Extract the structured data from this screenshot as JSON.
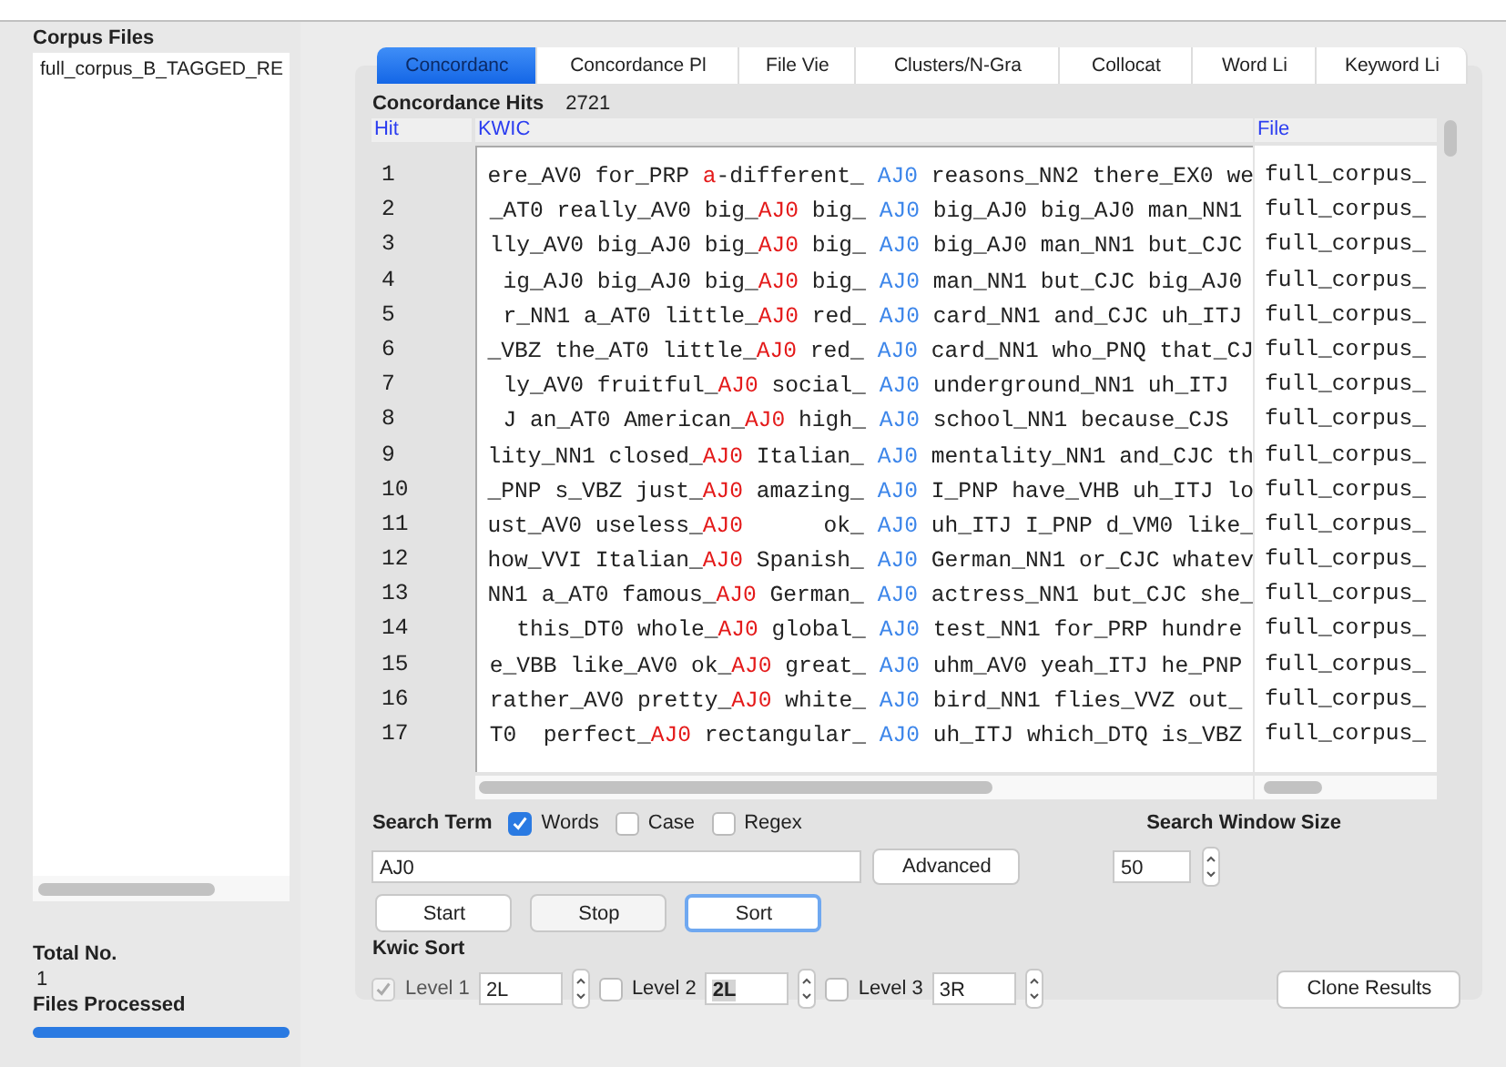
{
  "corpus_files": {
    "title": "Corpus Files",
    "items": [
      "full_corpus_B_TAGGED_RE"
    ]
  },
  "totals": {
    "total_label": "Total No.",
    "total_value": "1",
    "processed_label": "Files Processed",
    "progress": {
      "level": 1
    }
  },
  "tabs": [
    {
      "label": "Concordanc",
      "selected": true
    },
    {
      "label": "Concordance Pl",
      "selected": false
    },
    {
      "label": "File Vie",
      "selected": false
    },
    {
      "label": "Clusters/N-Gra",
      "selected": false
    },
    {
      "label": "Collocat",
      "selected": false
    },
    {
      "label": "Word Li",
      "selected": false
    },
    {
      "label": "Keyword Li",
      "selected": false
    }
  ],
  "hits": {
    "label": "Concordance Hits",
    "value": "2721"
  },
  "table": {
    "columns": [
      "Hit",
      "KWIC",
      "File"
    ],
    "rows": [
      {
        "hit": "1",
        "left": [
          {
            "text": "ere_AV0 for_PRP ",
            "sort_word": false
          },
          {
            "text": "a",
            "sort_word": true
          },
          {
            "text": "-different_",
            "sort_word": false
          }
        ],
        "keyword": "AJ0",
        "right": " reasons_NN2 there_EX0 we",
        "file": "full_corpus_"
      },
      {
        "hit": "2",
        "left": [
          {
            "text": "_AT0 really_AV0 big_",
            "sort_word": false
          },
          {
            "text": "AJ0",
            "sort_word": true
          },
          {
            "text": " big_",
            "sort_word": false
          }
        ],
        "keyword": "AJ0",
        "right": " big_AJ0 big_AJ0 man_NN1",
        "file": "full_corpus_"
      },
      {
        "hit": "3",
        "left": [
          {
            "text": "lly_AV0 big_AJ0 big_",
            "sort_word": false
          },
          {
            "text": "AJ0",
            "sort_word": true
          },
          {
            "text": " big_",
            "sort_word": false
          }
        ],
        "keyword": "AJ0",
        "right": " big_AJ0 man_NN1 but_CJC",
        "file": "full_corpus_"
      },
      {
        "hit": "4",
        "left": [
          {
            "text": "ig_AJ0 big_AJ0 big_",
            "sort_word": false
          },
          {
            "text": "AJ0",
            "sort_word": true
          },
          {
            "text": " big_",
            "sort_word": false
          }
        ],
        "keyword": "AJ0",
        "right": " man_NN1 but_CJC big_AJ0",
        "file": "full_corpus_"
      },
      {
        "hit": "5",
        "left": [
          {
            "text": "r_NN1 a_AT0 little_",
            "sort_word": false
          },
          {
            "text": "AJ0",
            "sort_word": true
          },
          {
            "text": " red_",
            "sort_word": false
          }
        ],
        "keyword": "AJ0",
        "right": " card_NN1 and_CJC uh_ITJ",
        "file": "full_corpus_"
      },
      {
        "hit": "6",
        "left": [
          {
            "text": "_VBZ the_AT0 little_",
            "sort_word": false
          },
          {
            "text": "AJ0",
            "sort_word": true
          },
          {
            "text": " red_",
            "sort_word": false
          }
        ],
        "keyword": "AJ0",
        "right": " card_NN1 who_PNQ that_CJ",
        "file": "full_corpus_"
      },
      {
        "hit": "7",
        "left": [
          {
            "text": "ly_AV0 fruitful_",
            "sort_word": false
          },
          {
            "text": "AJ0",
            "sort_word": true
          },
          {
            "text": " social_",
            "sort_word": false
          }
        ],
        "keyword": "AJ0",
        "right": " underground_NN1 uh_ITJ",
        "file": "full_corpus_"
      },
      {
        "hit": "8",
        "left": [
          {
            "text": "J an_AT0 American_",
            "sort_word": false
          },
          {
            "text": "AJ0",
            "sort_word": true
          },
          {
            "text": " high_",
            "sort_word": false
          }
        ],
        "keyword": "AJ0",
        "right": " school_NN1 because_CJS",
        "file": "full_corpus_"
      },
      {
        "hit": "9",
        "left": [
          {
            "text": "lity_NN1 closed_",
            "sort_word": false
          },
          {
            "text": "AJ0",
            "sort_word": true
          },
          {
            "text": " Italian_",
            "sort_word": false
          }
        ],
        "keyword": "AJ0",
        "right": " mentality_NN1 and_CJC th",
        "file": "full_corpus_"
      },
      {
        "hit": "10",
        "left": [
          {
            "text": "_PNP s_VBZ just_",
            "sort_word": false
          },
          {
            "text": "AJ0",
            "sort_word": true
          },
          {
            "text": " amazing_",
            "sort_word": false
          }
        ],
        "keyword": "AJ0",
        "right": " I_PNP have_VHB uh_ITJ lo",
        "file": "full_corpus_"
      },
      {
        "hit": "11",
        "left": [
          {
            "text": "ust_AV0 useless_",
            "sort_word": false
          },
          {
            "text": "AJ0",
            "sort_word": true
          },
          {
            "text": "      ok_",
            "sort_word": false
          }
        ],
        "keyword": "AJ0",
        "right": " uh_ITJ I_PNP d_VM0 like_",
        "file": "full_corpus_"
      },
      {
        "hit": "12",
        "left": [
          {
            "text": "how_VVI Italian_",
            "sort_word": false
          },
          {
            "text": "AJ0",
            "sort_word": true
          },
          {
            "text": " Spanish_",
            "sort_word": false
          }
        ],
        "keyword": "AJ0",
        "right": " German_NN1 or_CJC whatev",
        "file": "full_corpus_"
      },
      {
        "hit": "13",
        "left": [
          {
            "text": "NN1 a_AT0 famous_",
            "sort_word": false
          },
          {
            "text": "AJ0",
            "sort_word": true
          },
          {
            "text": " German_",
            "sort_word": false
          }
        ],
        "keyword": "AJ0",
        "right": " actress_NN1 but_CJC she_",
        "file": "full_corpus_"
      },
      {
        "hit": "14",
        "left": [
          {
            "text": " this_DT0 whole_",
            "sort_word": false
          },
          {
            "text": "AJ0",
            "sort_word": true
          },
          {
            "text": " global_",
            "sort_word": false
          }
        ],
        "keyword": "AJ0",
        "right": " test_NN1 for_PRP hundre",
        "file": "full_corpus_"
      },
      {
        "hit": "15",
        "left": [
          {
            "text": "e_VBB like_AV0 ok_",
            "sort_word": false
          },
          {
            "text": "AJ0",
            "sort_word": true
          },
          {
            "text": " great_",
            "sort_word": false
          }
        ],
        "keyword": "AJ0",
        "right": " uhm_AV0 yeah_ITJ he_PNP",
        "file": "full_corpus_"
      },
      {
        "hit": "16",
        "left": [
          {
            "text": "rather_AV0 pretty_",
            "sort_word": false
          },
          {
            "text": "AJ0",
            "sort_word": true
          },
          {
            "text": " white_",
            "sort_word": false
          }
        ],
        "keyword": "AJ0",
        "right": " bird_NN1 flies_VVZ out_",
        "file": "full_corpus_"
      },
      {
        "hit": "17",
        "left": [
          {
            "text": "T0  perfect_",
            "sort_word": false
          },
          {
            "text": "AJ0",
            "sort_word": true
          },
          {
            "text": " rectangular_",
            "sort_word": false
          }
        ],
        "keyword": "AJ0",
        "right": " uh_ITJ which_DTQ is_VBZ",
        "file": "full_corpus_"
      }
    ]
  },
  "search": {
    "label": "Search Term",
    "options": [
      {
        "label": "Words",
        "checked": true
      },
      {
        "label": "Case",
        "checked": false
      },
      {
        "label": "Regex",
        "checked": false
      }
    ],
    "value": "AJ0",
    "advanced": "Advanced",
    "window_label": "Search Window Size",
    "window_value": "50"
  },
  "buttons": [
    {
      "label": "Start",
      "focused": false
    },
    {
      "label": "Stop",
      "focused": false
    },
    {
      "label": "Sort",
      "focused": true
    }
  ],
  "kwic_sort": {
    "label": "Kwic Sort",
    "levels": [
      {
        "label": "Level 1",
        "checked": true,
        "disabled": true,
        "value": "2L",
        "text_selected": false
      },
      {
        "label": "Level 2",
        "checked": false,
        "disabled": false,
        "value": "2L",
        "text_selected": true
      },
      {
        "label": "Level 3",
        "checked": false,
        "disabled": false,
        "value": "3R",
        "text_selected": false
      }
    ],
    "clone": "Clone Results"
  }
}
